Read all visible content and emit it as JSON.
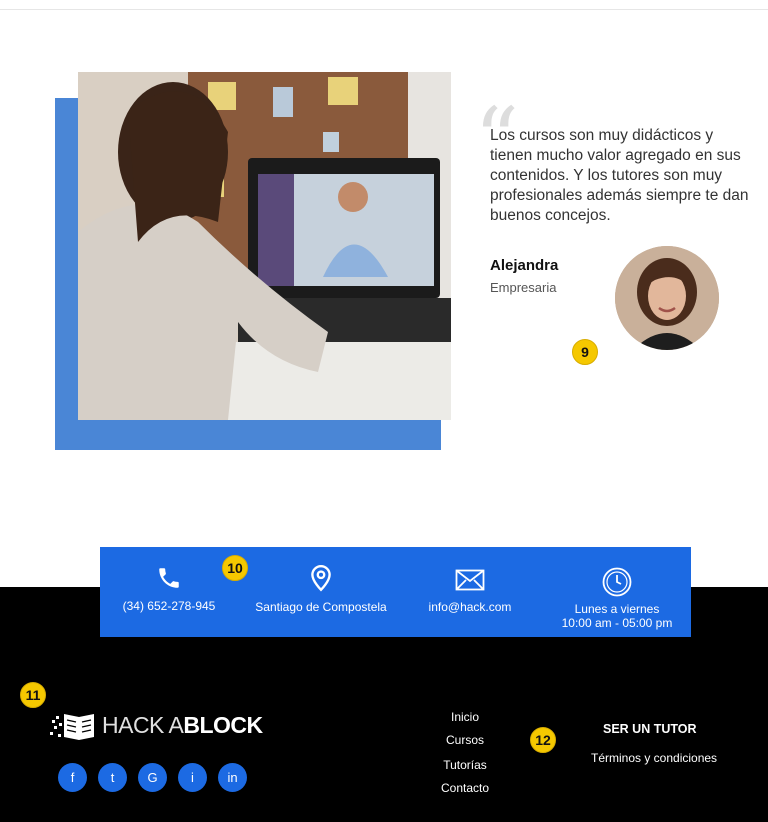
{
  "testimonial": {
    "quote": "Los cursos son muy didácticos y tienen mucho valor agregado en sus contenidos. Y los tutores son muy profesionales además siempre te dan buenos concejos.",
    "author_name": "Alejandra",
    "author_role": "Empresaria"
  },
  "badges": {
    "b9": "9",
    "b10": "10",
    "b11": "11",
    "b12": "12"
  },
  "contact": {
    "phone": "(34) 652-278-945",
    "location": "Santiago de Compostela",
    "email": "info@hack.com",
    "hours_line1": "Lunes a viernes",
    "hours_line2": "10:00 am - 05:00 pm"
  },
  "footer": {
    "brand_light": "HACK A",
    "brand_bold": "BLOCK",
    "socials": [
      "f",
      "t",
      "G",
      "i",
      "in"
    ],
    "nav": [
      "Inicio",
      "Cursos",
      "Tutorías",
      "Contacto"
    ],
    "tutor_title": "SER UN TUTOR",
    "terms": "Términos y condiciones"
  },
  "colors": {
    "primary_blue": "#1c6ae3",
    "badge_yellow": "#f5c800",
    "footer_black": "#000000"
  }
}
